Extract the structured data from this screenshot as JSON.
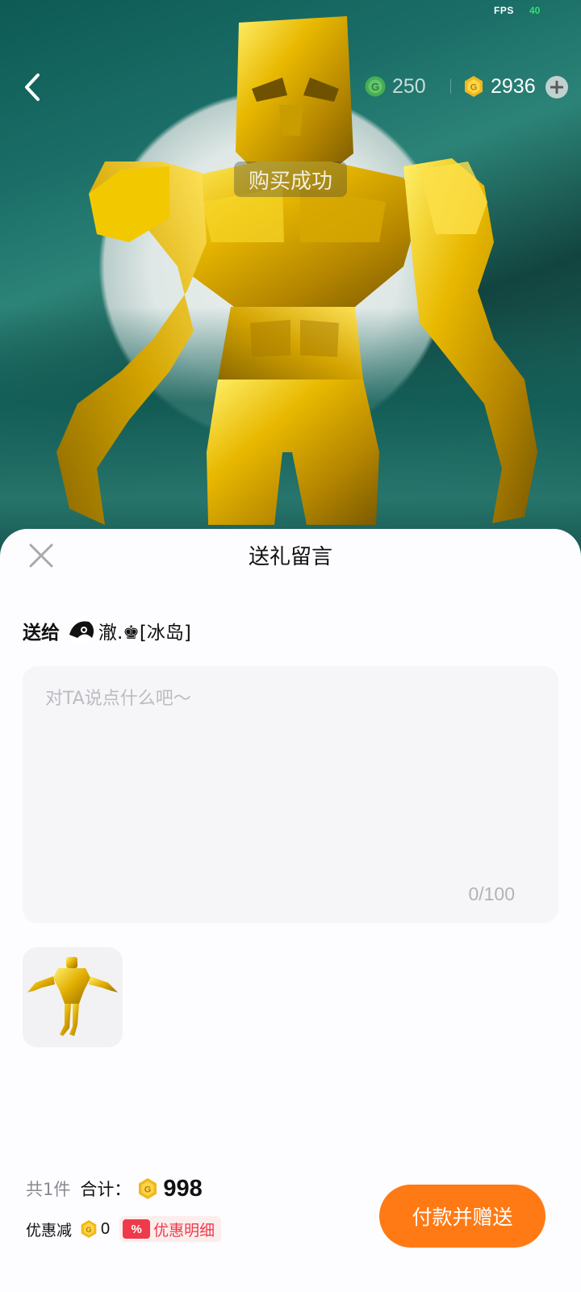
{
  "status_bar": {
    "fps_label": "FPS",
    "fps_value": "40"
  },
  "header": {
    "back_icon": "chevron-left-icon",
    "green_currency": {
      "icon": "green-coin-icon",
      "value": "250"
    },
    "gold_currency": {
      "icon": "gold-coin-icon",
      "value": "2936"
    },
    "add_icon": "plus-icon",
    "toast": "购买成功"
  },
  "sheet": {
    "title": "送礼留言",
    "close_icon": "close-icon",
    "recipient": {
      "label": "送给",
      "name": "澈.♚[冰岛]"
    },
    "message": {
      "placeholder": "对TA说点什么吧～",
      "value": "",
      "counter": "0/100"
    },
    "gift": {
      "name_icon": "golden-figure-gift"
    },
    "summary": {
      "count": "共1件",
      "total_label": "合计：",
      "total_value": "998",
      "discount_label": "优惠减",
      "discount_value": "0",
      "discount_tag": "%",
      "discount_detail": "优惠明细"
    },
    "pay_button": "付款并赠送"
  },
  "colors": {
    "accent": "#ff7a14",
    "discount_red": "#ef3a4a",
    "coin_gold": "#f1b81a",
    "coin_green": "#53c24a"
  }
}
